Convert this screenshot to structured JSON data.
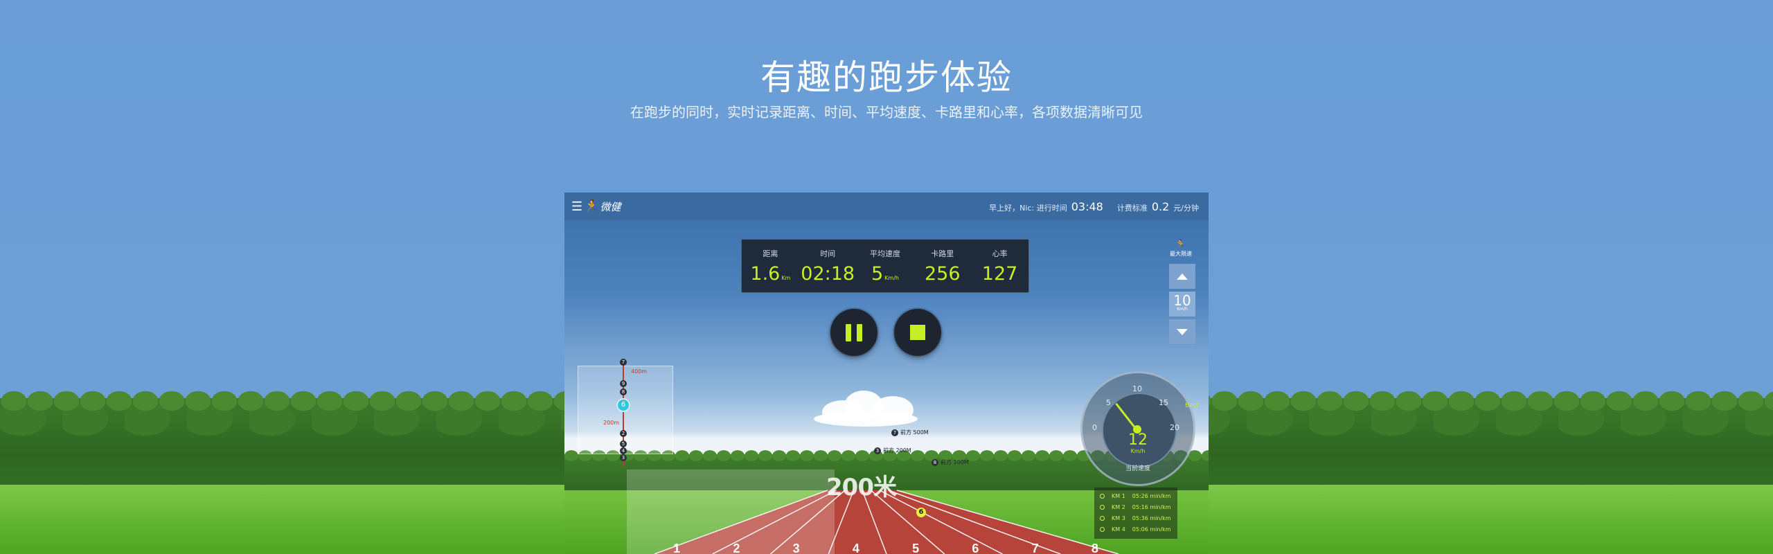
{
  "hero": {
    "title": "有趣的跑步体验",
    "subtitle": "在跑步的同时，实时记录距离、时间、平均速度、卡路里和心率，各项数据清晰可见"
  },
  "app": {
    "logo_text": "微健",
    "greeting": "早上好，Nic: 进行时间",
    "elapsed": "03:48",
    "billing_label": "计费标准",
    "billing_value": "0.2",
    "billing_unit": "元/分钟"
  },
  "stats": [
    {
      "label": "距离",
      "value": "1.6",
      "unit": "Km"
    },
    {
      "label": "时间",
      "value": "02:18",
      "unit": ""
    },
    {
      "label": "平均速度",
      "value": "5",
      "unit": "Km/h"
    },
    {
      "label": "卡路里",
      "value": "256",
      "unit": ""
    },
    {
      "label": "心率",
      "value": "127",
      "unit": ""
    }
  ],
  "speed_control": {
    "label": "最大限速",
    "value": "10",
    "unit": "Km/h"
  },
  "map": {
    "label_400": "400m",
    "label_200": "200m",
    "current": "6",
    "dots": [
      "7",
      "9",
      "8",
      "6",
      "2",
      "5",
      "4",
      "3"
    ]
  },
  "markers": [
    {
      "num": "7",
      "text": "前方 500M"
    },
    {
      "num": "3",
      "text": "前方 200M"
    },
    {
      "num": "8",
      "text": "前方 100M"
    }
  ],
  "track": {
    "sign": "200米",
    "runner": "6",
    "lanes": [
      "1",
      "2",
      "3",
      "4",
      "5",
      "6",
      "7",
      "8"
    ]
  },
  "gauge": {
    "ticks": [
      "0",
      "5",
      "10",
      "15",
      "20"
    ],
    "value": "12",
    "unit": "Km/h",
    "caption": "当前速度",
    "best_label": "Best"
  },
  "splits": [
    {
      "km": "KM 1",
      "pace": "05:26 min/km"
    },
    {
      "km": "KM 2",
      "pace": "05:16 min/km"
    },
    {
      "km": "KM 3",
      "pace": "05:36 min/km"
    },
    {
      "km": "KM 4",
      "pace": "05:06 min/km"
    }
  ],
  "colors": {
    "accent": "#c6ee24",
    "background": "#6a9dd6",
    "track": "#b7443a"
  }
}
